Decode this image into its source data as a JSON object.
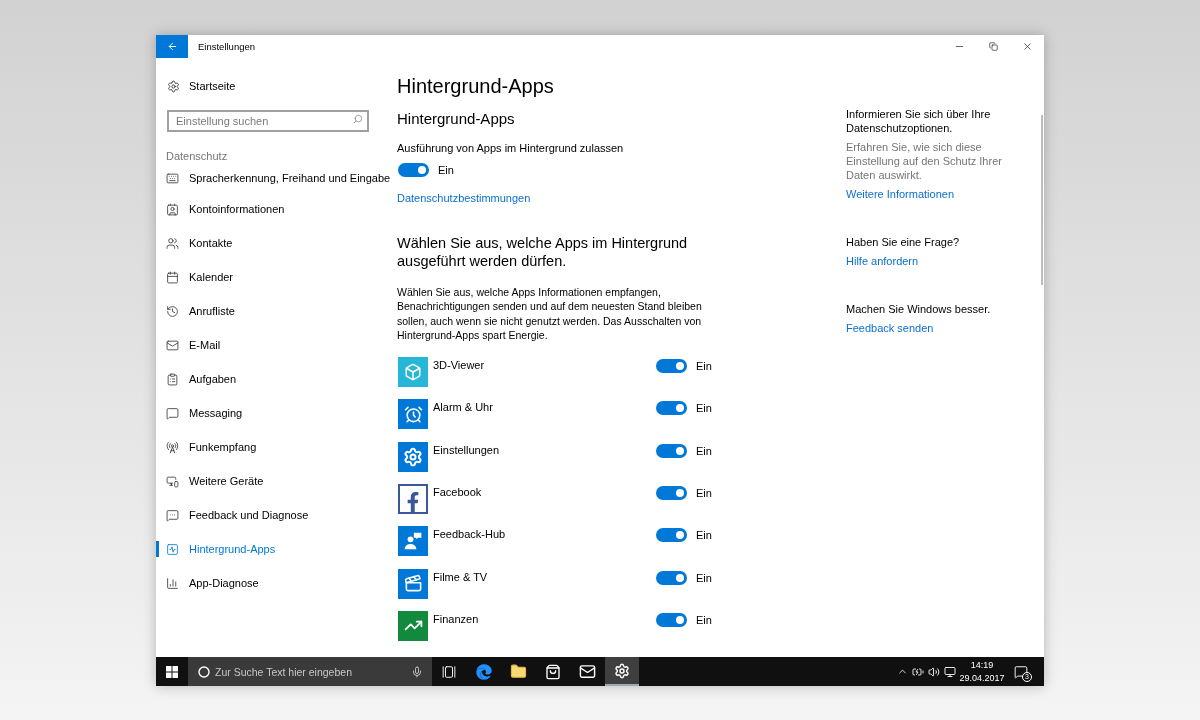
{
  "window": {
    "title": "Einstellungen"
  },
  "sidebar": {
    "home": "Startseite",
    "search": {
      "placeholder": "Einstellung suchen"
    },
    "section": "Datenschutz",
    "items": [
      {
        "label": "Spracherkennung, Freihand und Eingabe",
        "selected": false
      },
      {
        "label": "Kontoinformationen",
        "selected": false
      },
      {
        "label": "Kontakte",
        "selected": false
      },
      {
        "label": "Kalender",
        "selected": false
      },
      {
        "label": "Anrufliste",
        "selected": false
      },
      {
        "label": "E-Mail",
        "selected": false
      },
      {
        "label": "Aufgaben",
        "selected": false
      },
      {
        "label": "Messaging",
        "selected": false
      },
      {
        "label": "Funkempfang",
        "selected": false
      },
      {
        "label": "Weitere Geräte",
        "selected": false
      },
      {
        "label": "Feedback und Diagnose",
        "selected": false
      },
      {
        "label": "Hintergrund-Apps",
        "selected": true
      },
      {
        "label": "App-Diagnose",
        "selected": false
      }
    ]
  },
  "main": {
    "title": "Hintergrund-Apps",
    "section_title": "Hintergrund-Apps",
    "master_toggle": {
      "label": "Ausführung von Apps im Hintergrund zulassen",
      "on": true,
      "state_text": "Ein"
    },
    "privacy_link": "Datenschutzbestimmungen",
    "heading": "Wählen Sie aus, welche Apps im Hintergrund ausgeführt werden dürfen.",
    "description": "Wählen Sie aus, welche Apps Informationen empfangen, Benachrichtigungen senden und auf dem neuesten Stand bleiben sollen, auch wenn sie nicht genutzt werden. Das Ausschalten von Hintergrund-Apps spart Energie.",
    "apps": [
      {
        "name": "3D-Viewer",
        "on": true,
        "state_text": "Ein"
      },
      {
        "name": "Alarm & Uhr",
        "on": true,
        "state_text": "Ein"
      },
      {
        "name": "Einstellungen",
        "on": true,
        "state_text": "Ein"
      },
      {
        "name": "Facebook",
        "on": true,
        "state_text": "Ein"
      },
      {
        "name": "Feedback-Hub",
        "on": true,
        "state_text": "Ein"
      },
      {
        "name": "Filme & TV",
        "on": true,
        "state_text": "Ein"
      },
      {
        "name": "Finanzen",
        "on": true,
        "state_text": "Ein"
      }
    ]
  },
  "aside": {
    "sections": [
      {
        "title": "Informieren Sie sich über Ihre Datenschutzoptionen.",
        "text": "Erfahren Sie, wie sich diese Einstellung auf den Schutz Ihrer Daten auswirkt.",
        "link": "Weitere Informationen"
      },
      {
        "title": "Haben Sie eine Frage?",
        "link": "Hilfe anfordern"
      },
      {
        "title": "Machen Sie Windows besser.",
        "link": "Feedback senden"
      }
    ]
  },
  "taskbar": {
    "search": {
      "placeholder": "Zur Suche Text hier eingeben"
    },
    "pinned": [
      {
        "selected": false
      },
      {
        "selected": false
      },
      {
        "selected": false
      },
      {
        "selected": false
      },
      {
        "selected": true
      }
    ],
    "time": "14:19",
    "date": "29.04.2017",
    "notification_count": "3"
  }
}
